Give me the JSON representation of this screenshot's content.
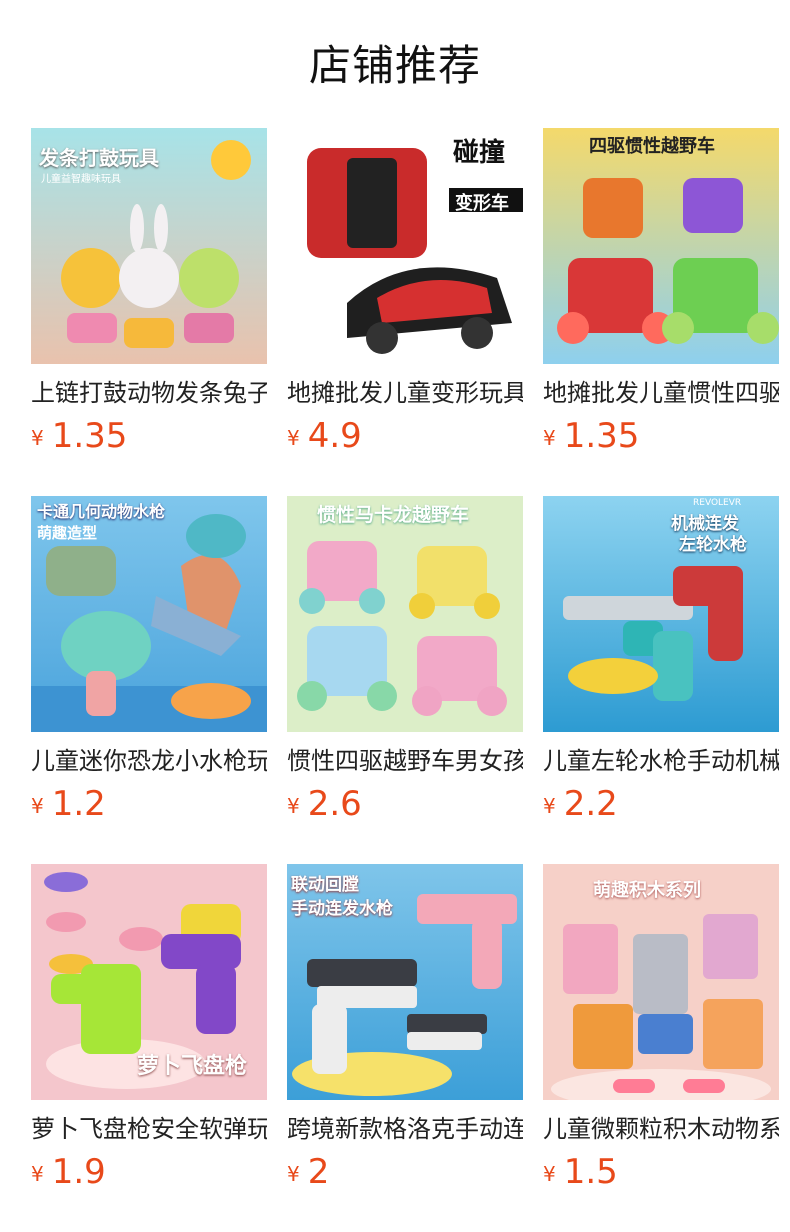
{
  "header": {
    "title": "店铺推荐"
  },
  "currency_symbol": "¥",
  "products": [
    {
      "name": "上链打鼓动物发条兔子",
      "price": "1.35",
      "image_text": "发条打鼓玩具",
      "image_subtext": "儿童益智趣味玩具"
    },
    {
      "name": "地摊批发儿童变形玩具",
      "price": "4.9",
      "image_text": "碰撞",
      "image_subtext": "变形车"
    },
    {
      "name": "地摊批发儿童惯性四驱",
      "price": "1.35",
      "image_text": "四驱惯性越野车",
      "image_subtext": ""
    },
    {
      "name": "儿童迷你恐龙小水枪玩具",
      "price": "1.2",
      "image_text": "卡通几何动物水枪",
      "image_subtext": "萌趣造型"
    },
    {
      "name": "惯性四驱越野车男女孩",
      "price": "2.6",
      "image_text": "惯性马卡龙越野车",
      "image_subtext": ""
    },
    {
      "name": "儿童左轮水枪手动机械",
      "price": "2.2",
      "image_text": "机械连发",
      "image_subtext": "左轮水枪"
    },
    {
      "name": "萝卜飞盘枪安全软弹玩具",
      "price": "1.9",
      "image_text": "萝卜飞盘枪",
      "image_subtext": ""
    },
    {
      "name": "跨境新款格洛克手动连发",
      "price": "2",
      "image_text": "联动回膛",
      "image_subtext": "手动连发水枪"
    },
    {
      "name": "儿童微颗粒积木动物系列",
      "price": "1.5",
      "image_text": "萌趣积木系列",
      "image_subtext": ""
    }
  ],
  "colors": {
    "price": "#e8491a",
    "title": "#111111"
  }
}
